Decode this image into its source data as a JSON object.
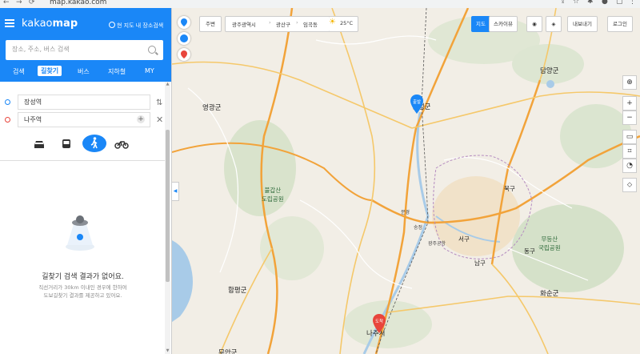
{
  "browser": {
    "url": "map.kakao.com"
  },
  "sidebar": {
    "logo_text": "kakao",
    "logo_bold": "map",
    "area_search_label": "현 지도 내 장소검색",
    "search_placeholder": "장소, 주소, 버스 검색",
    "tabs": [
      {
        "label": "검색",
        "active": false
      },
      {
        "label": "길찾기",
        "active": true
      },
      {
        "label": "버스",
        "active": false
      },
      {
        "label": "지하철",
        "active": false
      },
      {
        "label": "MY",
        "active": false
      }
    ],
    "origin": "장성역",
    "destination": "나주역",
    "modes": [
      {
        "name": "car",
        "active": false
      },
      {
        "name": "transit",
        "active": false
      },
      {
        "name": "walk",
        "active": true
      },
      {
        "name": "bike",
        "active": false
      }
    ],
    "empty_title": "길찾기 검색 결과가 없어요.",
    "empty_desc_1": "직선거리가 30km 이내인 경우에 한하여",
    "empty_desc_2": "도보길찾기 결과를 제공하고 있어요."
  },
  "map": {
    "view_button": "주변",
    "breadcrumb": [
      "광주광역시",
      "광산구",
      "임곡동"
    ],
    "weather": "25°C",
    "map_type_buttons": [
      "지도",
      "스카이뷰"
    ],
    "active_map_type": "지도",
    "share_label": "내보내기",
    "login_label": "로그인",
    "origin_badge": "출발",
    "dest_badge": "도착",
    "labels": {
      "yeonggwang": "영광군",
      "jangseong": "장성군",
      "damyang": "담양군",
      "hampyeong": "함평군",
      "naju": "나주시",
      "hwasun": "화순군",
      "muan": "무안군",
      "bulgapsan": "불갑산\n도립공원",
      "mudeung": "무등산\n국립공원",
      "gwangju_airport": "광주공항",
      "seo_gu": "서구",
      "nam_gu": "남구",
      "dong_gu": "동구",
      "buk_gu": "북구",
      "songjeong": "송정",
      "mungyeong": "문경"
    }
  }
}
